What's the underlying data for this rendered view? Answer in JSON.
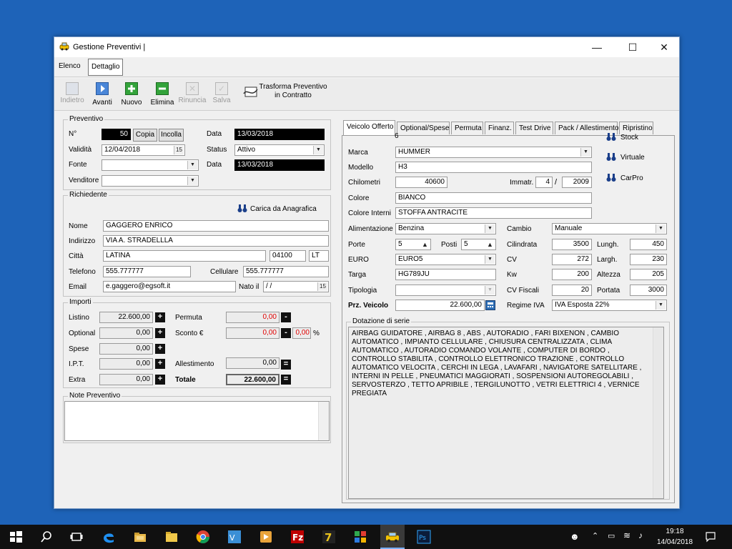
{
  "window": {
    "title": "Gestione Preventivi |",
    "tabs": [
      "Elenco",
      "Dettaglio"
    ]
  },
  "toolbar": {
    "indietro": "Indietro",
    "avanti": "Avanti",
    "nuovo": "Nuovo",
    "elimina": "Elimina",
    "rinuncia": "Rinuncia",
    "salva": "Salva",
    "trasforma_1": "Trasforma Preventivo",
    "trasforma_2": "in Contratto"
  },
  "preventivo": {
    "caption": "Preventivo",
    "no_label": "N°",
    "no_value": "50",
    "copia": "Copia",
    "incolla": "Incolla",
    "data_label": "Data",
    "data_value": "13/03/2018",
    "validita_label": "Validità",
    "validita_value": "12/04/2018",
    "status_label": "Status",
    "status_value": "Attivo",
    "fonte_label": "Fonte",
    "fonte_value": "",
    "data2_label": "Data",
    "data2_value": "13/03/2018",
    "venditore_label": "Venditore",
    "venditore_value": ""
  },
  "richiedente": {
    "caption": "Richiedente",
    "carica": "Carica da Anagrafica",
    "nome_label": "Nome",
    "nome": "GAGGERO ENRICO",
    "indirizzo_label": "Indirizzo",
    "indirizzo": "VIA A. STRADELLLA",
    "citta_label": "Città",
    "citta": "LATINA",
    "cap": "04100",
    "prov": "LT",
    "telefono_label": "Telefono",
    "telefono": "555.777777",
    "cellulare_label": "Cellulare",
    "cellulare": "555.777777",
    "email_label": "Email",
    "email": "e.gaggero@egsoft.it",
    "nato_label": "Nato il",
    "nato": " / /"
  },
  "importi": {
    "caption": "Importi",
    "listino_label": "Listino",
    "listino": "22.600,00",
    "optional_label": "Optional",
    "optional": "0,00",
    "spese_label": "Spese",
    "spese": "0,00",
    "ipt_label": "I.P.T.",
    "ipt": "0,00",
    "extra_label": "Extra",
    "extra": "0,00",
    "permuta_label": "Permuta",
    "permuta": "0,00",
    "sconto_label": "Sconto €",
    "sconto": "0,00",
    "sconto_pct": "0,00",
    "pct": "%",
    "allestimento_label": "Allestimento",
    "allestimento": "0,00",
    "totale_label": "Totale",
    "totale": "22.600,00"
  },
  "note": {
    "caption": "Note Preventivo",
    "value": ""
  },
  "right_tabs": [
    "Veicolo Offerto",
    "Optional/Spese",
    "Permuta",
    "Finanz.",
    "Test Drive",
    "Pack / Allestimento",
    "Ripristino"
  ],
  "veicolo": {
    "id": "6",
    "stock": "Stock",
    "virtuale": "Virtuale",
    "carpro": "CarPro",
    "marca_label": "Marca",
    "marca": "HUMMER",
    "modello_label": "Modello",
    "modello": "H3",
    "chilometri_label": "Chilometri",
    "chilometri": "40600",
    "immatr_label": "Immatr.",
    "immatr_mese": "4",
    "slash": "/",
    "immatr_anno": "2009",
    "colore_label": "Colore",
    "colore": "BIANCO",
    "interni_label": "Colore Interni",
    "interni": "STOFFA ANTRACITE",
    "alimentazione_label": "Alimentazione",
    "alimentazione": "Benzina",
    "cambio_label": "Cambio",
    "cambio": "Manuale",
    "porte_label": "Porte",
    "porte": "5",
    "posti_label": "Posti",
    "posti": "5",
    "cilindrata_label": "Cilindrata",
    "cilindrata": "3500",
    "lungh_label": "Lungh.",
    "lungh": "450",
    "euro_label": "EURO",
    "euro": "EURO5",
    "cv_label": "CV",
    "cv": "272",
    "largh_label": "Largh.",
    "largh": "230",
    "targa_label": "Targa",
    "targa": "HG789JU",
    "kw_label": "Kw",
    "kw": "200",
    "altezza_label": "Altezza",
    "altezza": "205",
    "tipologia_label": "Tipologia",
    "tipologia": "",
    "cvfiscali_label": "CV Fiscali",
    "cvfiscali": "20",
    "portata_label": "Portata",
    "portata": "3000",
    "prezzo_label": "Prz. Veicolo",
    "prezzo": "22.600,00",
    "regime_label": "Regime IVA",
    "regime": "IVA Esposta 22%",
    "dotazione_caption": "Dotazione di serie",
    "dotazione": "AIRBAG GUIDATORE , AIRBAG 8 , ABS , AUTORADIO , FARI BIXENON , CAMBIO AUTOMATICO , IMPIANTO CELLULARE , CHIUSURA CENTRALIZZATA , CLIMA AUTOMATICO , AUTORADIO COMANDO VOLANTE , COMPUTER DI BORDO , CONTROLLO STABILITA , CONTROLLO ELETTRONICO TRAZIONE , CONTROLLO AUTOMATICO VELOCITA , CERCHI IN LEGA , LAVAFARI , NAVIGATORE SATELLITARE , INTERNI IN PELLE , PNEUMATICI MAGGIORATI , SOSPENSIONI AUTOREGOLABILI , SERVOSTERZO , TETTO APRIBILE , TERGILUNOTTO , VETRI ELETTRICI 4 , VERNICE PREGIATA"
  },
  "taskbar": {
    "time": "19:18",
    "date": "14/04/2018"
  },
  "colors": {
    "desktop": "#1e63b8",
    "dark_field": "#000000",
    "red_value": "#e00000"
  }
}
